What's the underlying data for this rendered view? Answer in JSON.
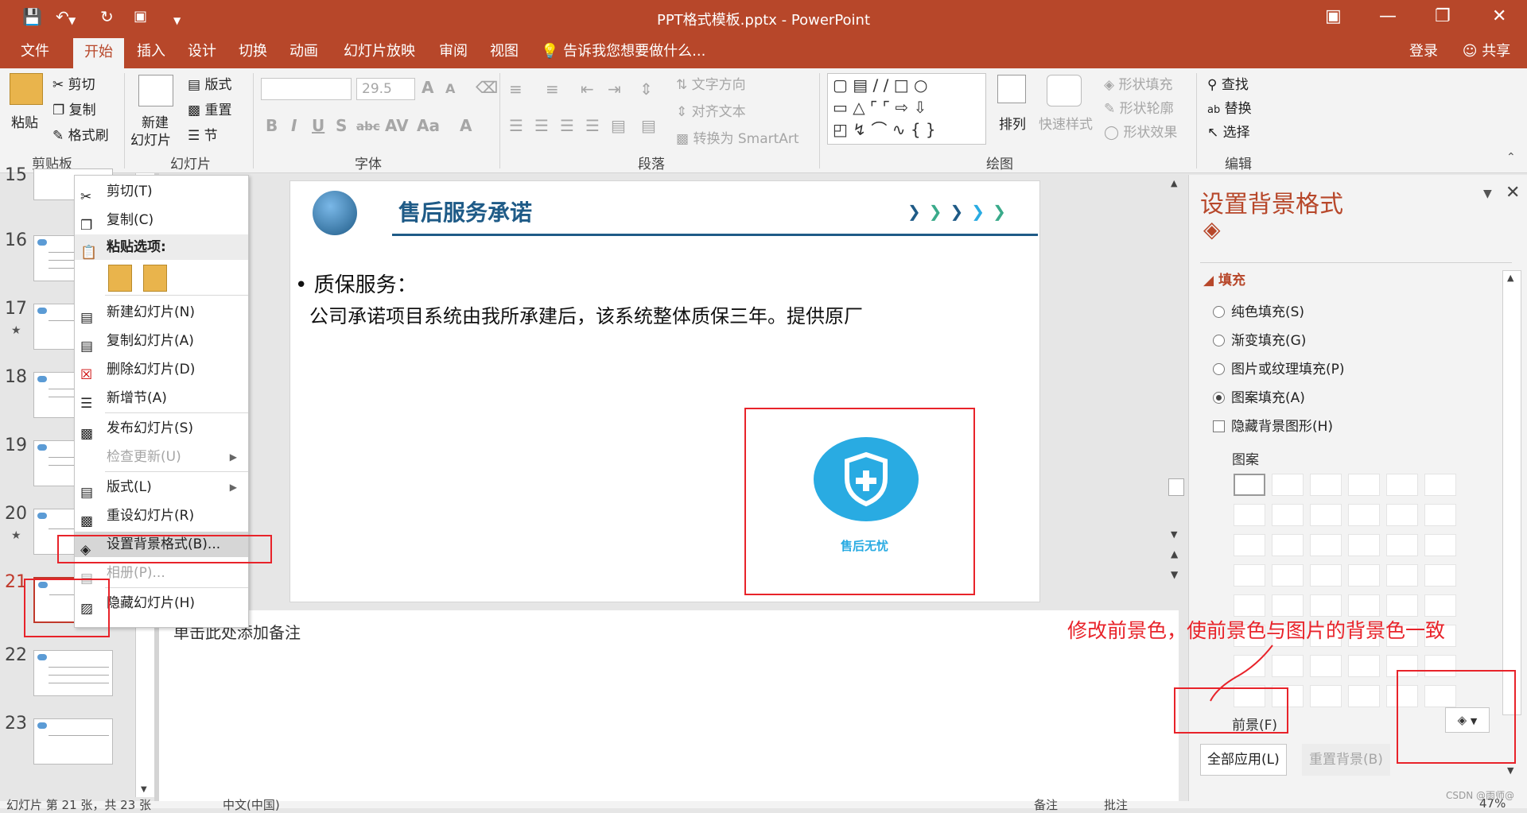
{
  "window": {
    "title": "PPT格式模板.pptx - PowerPoint"
  },
  "tabs": [
    "文件",
    "开始",
    "插入",
    "设计",
    "切换",
    "动画",
    "幻灯片放映",
    "审阅",
    "视图"
  ],
  "tell_me": "告诉我您想要做什么...",
  "account": {
    "login": "登录",
    "share": "共享"
  },
  "ribbon": {
    "clipboard": {
      "paste": "粘贴",
      "cut": "剪切",
      "copy": "复制",
      "format_painter": "格式刷",
      "label": "剪贴板"
    },
    "slides": {
      "new_slide_1": "新建",
      "new_slide_2": "幻灯片",
      "layout": "版式",
      "reset": "重置",
      "section": "节",
      "label": "幻灯片"
    },
    "font": {
      "size": "29.5",
      "label": "字体"
    },
    "paragraph": {
      "text_direction": "文字方向",
      "align_text": "对齐文本",
      "smartart": "转换为 SmartArt",
      "label": "段落"
    },
    "drawing": {
      "arrange": "排列",
      "quick_styles": "快速样式",
      "shape_fill": "形状填充",
      "shape_outline": "形状轮廓",
      "shape_effects": "形状效果",
      "label": "绘图"
    },
    "editing": {
      "find": "查找",
      "replace": "替换",
      "select": "选择",
      "label": "编辑"
    }
  },
  "thumbnails": [
    {
      "num": "15"
    },
    {
      "num": "16"
    },
    {
      "num": "17",
      "star": "★"
    },
    {
      "num": "18"
    },
    {
      "num": "19"
    },
    {
      "num": "20",
      "star": "★"
    },
    {
      "num": "21"
    },
    {
      "num": "22"
    },
    {
      "num": "23"
    }
  ],
  "context_menu": {
    "cut": "剪切(T)",
    "copy": "复制(C)",
    "paste_options": "粘贴选项:",
    "new_slide": "新建幻灯片(N)",
    "duplicate_slide": "复制幻灯片(A)",
    "delete_slide": "删除幻灯片(D)",
    "add_section": "新增节(A)",
    "publish_slides": "发布幻灯片(S)",
    "check_updates": "检查更新(U)",
    "layout": "版式(L)",
    "reset_slide": "重设幻灯片(R)",
    "format_background": "设置背景格式(B)...",
    "photo_album": "相册(P)...",
    "hide_slide": "隐藏幻灯片(H)"
  },
  "slide": {
    "title": "售后服务承诺",
    "bullet": "质保服务：",
    "body": "公司承诺项目系统由我所承建后，该系统整体质保三年。提供原厂",
    "badge_label": "售后无忧"
  },
  "notes_placeholder": "单击此处添加备注",
  "format_panel": {
    "title": "设置背景格式",
    "section": "填充",
    "options": [
      {
        "label": "纯色填充(S)",
        "checked": false
      },
      {
        "label": "渐变填充(G)",
        "checked": false
      },
      {
        "label": "图片或纹理填充(P)",
        "checked": false
      },
      {
        "label": "图案填充(A)",
        "checked": true
      }
    ],
    "hide_bg_graphics": "隐藏背景图形(H)",
    "pattern_label": "图案",
    "foreground_label": "前景(F)",
    "apply_all": "全部应用(L)",
    "reset_bg": "重置背景(B)"
  },
  "annotation": "修改前景色，使前景色与图片的背景色一致",
  "statusbar": {
    "slide_info": "幻灯片 第 21 张，共 23 张",
    "language": "中文(中国)",
    "notes": "备注",
    "comments": "批注",
    "zoom": "47%"
  },
  "watermark": "CSDN @雨师@",
  "colors": {
    "accent": "#b7472a",
    "annotation_red": "#e8232a",
    "badge_blue": "#29abe2",
    "title_blue": "#1f5b87"
  }
}
